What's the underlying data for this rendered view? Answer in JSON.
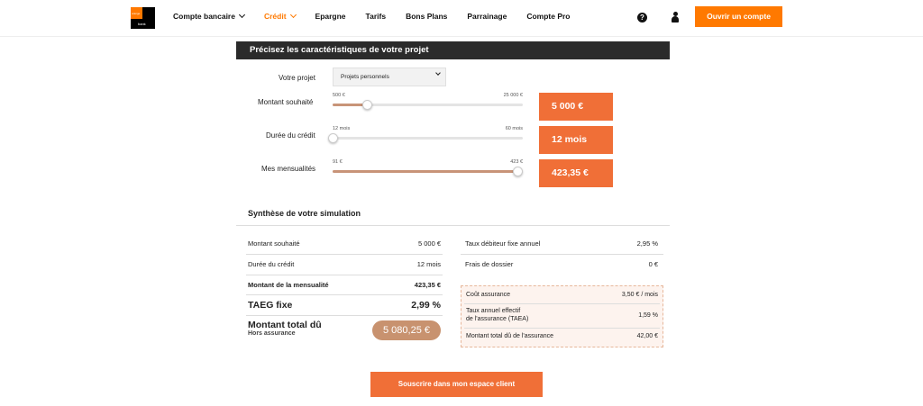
{
  "header": {
    "logo_top": "orange",
    "logo_bottom": "bank",
    "nav": [
      {
        "label": "Compte bancaire",
        "dropdown": true,
        "active": false
      },
      {
        "label": "Crédit",
        "dropdown": true,
        "active": true
      },
      {
        "label": "Epargne",
        "dropdown": false,
        "active": false
      },
      {
        "label": "Tarifs",
        "dropdown": false,
        "active": false
      },
      {
        "label": "Bons Plans",
        "dropdown": false,
        "active": false
      },
      {
        "label": "Parrainage",
        "dropdown": false,
        "active": false
      },
      {
        "label": "Compte Pro",
        "dropdown": false,
        "active": false
      }
    ],
    "help_icon": "?",
    "open_account": "Ouvrir un compte"
  },
  "project": {
    "section_title": "Précisez les caractéristiques de votre projet",
    "project_label": "Votre projet",
    "project_value": "Projets personnels",
    "amount_label": "Montant souhaité",
    "amount_min": "500 €",
    "amount_max": "25 000 €",
    "amount_fraction": 0.18,
    "amount_value": "5 000  €",
    "duration_label": "Durée du crédit",
    "duration_min": "12 mois",
    "duration_max": "60 mois",
    "duration_fraction": 0.0,
    "duration_value": "12  mois",
    "monthly_label": "Mes mensualités",
    "monthly_min": "91 €",
    "monthly_max": "423 €",
    "monthly_fraction": 1.0,
    "monthly_value": "423,35  €"
  },
  "summary": {
    "title": "Synthèse de votre simulation",
    "amount_label": "Montant souhaité",
    "amount_value": "5 000 €",
    "duration_label": "Durée du crédit",
    "duration_value": "12  mois",
    "monthly_label": "Montant de la mensualité",
    "monthly_value": "423,35 €",
    "taeg_label": "TAEG fixe",
    "taeg_value": "2,99 %",
    "total_label": "Montant total dû",
    "total_sub": "Hors assurance",
    "total_value": "5 080,25 €",
    "rate_label": "Taux débiteur fixe annuel",
    "rate_value": "2,95 %",
    "fees_label": "Frais de dossier",
    "fees_value": "0 €",
    "ins_cost_label": "Coût assurance",
    "ins_cost_value": "3,50 € / mois",
    "ins_taea_label_1": "Taux annuel effectif",
    "ins_taea_label_2": "de l'assurance (TAEA)",
    "ins_taea_value": "1,59 %",
    "ins_total_label": "Montant total dû de l'assurance",
    "ins_total_value": "42,00 €"
  },
  "cta": "Souscrire dans mon espace client",
  "colors": {
    "brand": "#ff7900",
    "value_box": "#f06f37",
    "slider_fill": "#c89478",
    "pill": "#c8926f"
  }
}
